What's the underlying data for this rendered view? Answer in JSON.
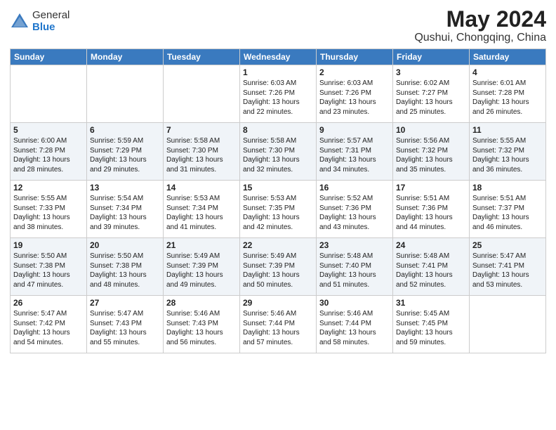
{
  "header": {
    "logo_general": "General",
    "logo_blue": "Blue",
    "month": "May 2024",
    "location": "Qushui, Chongqing, China"
  },
  "weekdays": [
    "Sunday",
    "Monday",
    "Tuesday",
    "Wednesday",
    "Thursday",
    "Friday",
    "Saturday"
  ],
  "weeks": [
    [
      {
        "day": "",
        "info": ""
      },
      {
        "day": "",
        "info": ""
      },
      {
        "day": "",
        "info": ""
      },
      {
        "day": "1",
        "info": "Sunrise: 6:03 AM\nSunset: 7:26 PM\nDaylight: 13 hours\nand 22 minutes."
      },
      {
        "day": "2",
        "info": "Sunrise: 6:03 AM\nSunset: 7:26 PM\nDaylight: 13 hours\nand 23 minutes."
      },
      {
        "day": "3",
        "info": "Sunrise: 6:02 AM\nSunset: 7:27 PM\nDaylight: 13 hours\nand 25 minutes."
      },
      {
        "day": "4",
        "info": "Sunrise: 6:01 AM\nSunset: 7:28 PM\nDaylight: 13 hours\nand 26 minutes."
      }
    ],
    [
      {
        "day": "5",
        "info": "Sunrise: 6:00 AM\nSunset: 7:28 PM\nDaylight: 13 hours\nand 28 minutes."
      },
      {
        "day": "6",
        "info": "Sunrise: 5:59 AM\nSunset: 7:29 PM\nDaylight: 13 hours\nand 29 minutes."
      },
      {
        "day": "7",
        "info": "Sunrise: 5:58 AM\nSunset: 7:30 PM\nDaylight: 13 hours\nand 31 minutes."
      },
      {
        "day": "8",
        "info": "Sunrise: 5:58 AM\nSunset: 7:30 PM\nDaylight: 13 hours\nand 32 minutes."
      },
      {
        "day": "9",
        "info": "Sunrise: 5:57 AM\nSunset: 7:31 PM\nDaylight: 13 hours\nand 34 minutes."
      },
      {
        "day": "10",
        "info": "Sunrise: 5:56 AM\nSunset: 7:32 PM\nDaylight: 13 hours\nand 35 minutes."
      },
      {
        "day": "11",
        "info": "Sunrise: 5:55 AM\nSunset: 7:32 PM\nDaylight: 13 hours\nand 36 minutes."
      }
    ],
    [
      {
        "day": "12",
        "info": "Sunrise: 5:55 AM\nSunset: 7:33 PM\nDaylight: 13 hours\nand 38 minutes."
      },
      {
        "day": "13",
        "info": "Sunrise: 5:54 AM\nSunset: 7:34 PM\nDaylight: 13 hours\nand 39 minutes."
      },
      {
        "day": "14",
        "info": "Sunrise: 5:53 AM\nSunset: 7:34 PM\nDaylight: 13 hours\nand 41 minutes."
      },
      {
        "day": "15",
        "info": "Sunrise: 5:53 AM\nSunset: 7:35 PM\nDaylight: 13 hours\nand 42 minutes."
      },
      {
        "day": "16",
        "info": "Sunrise: 5:52 AM\nSunset: 7:36 PM\nDaylight: 13 hours\nand 43 minutes."
      },
      {
        "day": "17",
        "info": "Sunrise: 5:51 AM\nSunset: 7:36 PM\nDaylight: 13 hours\nand 44 minutes."
      },
      {
        "day": "18",
        "info": "Sunrise: 5:51 AM\nSunset: 7:37 PM\nDaylight: 13 hours\nand 46 minutes."
      }
    ],
    [
      {
        "day": "19",
        "info": "Sunrise: 5:50 AM\nSunset: 7:38 PM\nDaylight: 13 hours\nand 47 minutes."
      },
      {
        "day": "20",
        "info": "Sunrise: 5:50 AM\nSunset: 7:38 PM\nDaylight: 13 hours\nand 48 minutes."
      },
      {
        "day": "21",
        "info": "Sunrise: 5:49 AM\nSunset: 7:39 PM\nDaylight: 13 hours\nand 49 minutes."
      },
      {
        "day": "22",
        "info": "Sunrise: 5:49 AM\nSunset: 7:39 PM\nDaylight: 13 hours\nand 50 minutes."
      },
      {
        "day": "23",
        "info": "Sunrise: 5:48 AM\nSunset: 7:40 PM\nDaylight: 13 hours\nand 51 minutes."
      },
      {
        "day": "24",
        "info": "Sunrise: 5:48 AM\nSunset: 7:41 PM\nDaylight: 13 hours\nand 52 minutes."
      },
      {
        "day": "25",
        "info": "Sunrise: 5:47 AM\nSunset: 7:41 PM\nDaylight: 13 hours\nand 53 minutes."
      }
    ],
    [
      {
        "day": "26",
        "info": "Sunrise: 5:47 AM\nSunset: 7:42 PM\nDaylight: 13 hours\nand 54 minutes."
      },
      {
        "day": "27",
        "info": "Sunrise: 5:47 AM\nSunset: 7:43 PM\nDaylight: 13 hours\nand 55 minutes."
      },
      {
        "day": "28",
        "info": "Sunrise: 5:46 AM\nSunset: 7:43 PM\nDaylight: 13 hours\nand 56 minutes."
      },
      {
        "day": "29",
        "info": "Sunrise: 5:46 AM\nSunset: 7:44 PM\nDaylight: 13 hours\nand 57 minutes."
      },
      {
        "day": "30",
        "info": "Sunrise: 5:46 AM\nSunset: 7:44 PM\nDaylight: 13 hours\nand 58 minutes."
      },
      {
        "day": "31",
        "info": "Sunrise: 5:45 AM\nSunset: 7:45 PM\nDaylight: 13 hours\nand 59 minutes."
      },
      {
        "day": "",
        "info": ""
      }
    ]
  ]
}
